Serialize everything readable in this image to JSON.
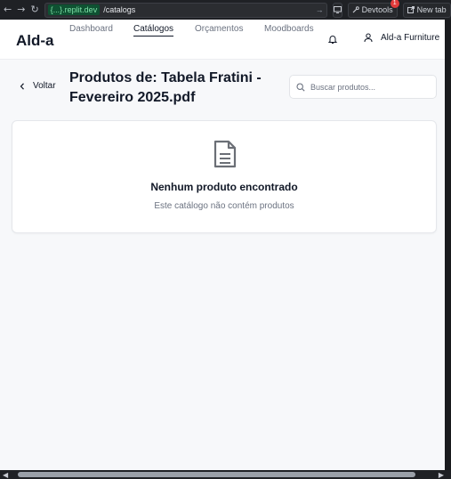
{
  "browser": {
    "url_domain": "{...}.replit.dev",
    "url_path": "/catalogs",
    "devtools_label": "Devtools",
    "devtools_badge": "1",
    "new_tab_label": "New tab"
  },
  "header": {
    "logo": "Ald-a",
    "nav": [
      {
        "label": "Dashboard",
        "active": false
      },
      {
        "label": "Catálogos",
        "active": true
      },
      {
        "label": "Orçamentos",
        "active": false
      },
      {
        "label": "Moodboards",
        "active": false
      }
    ],
    "user_name": "Ald-a Furniture"
  },
  "page": {
    "back_label": "Voltar",
    "title": "Produtos de: Tabela Fratini - Fevereiro 2025.pdf",
    "search_placeholder": "Buscar produtos...",
    "empty_title": "Nenhum produto encontrado",
    "empty_subtitle": "Este catálogo não contém produtos"
  },
  "colors": {
    "page_bg": "#f7f8fa",
    "chrome_bg": "#1f2125",
    "url_domain_bg": "#0f5132",
    "badge": "#e23b3b"
  }
}
